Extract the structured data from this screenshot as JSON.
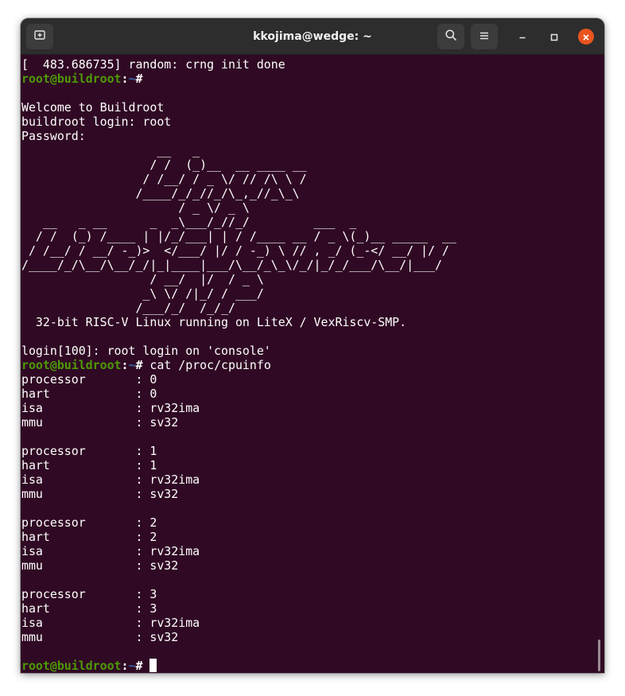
{
  "window": {
    "title": "kkojima@wedge: ~"
  },
  "titlebar": {
    "new_tab_icon": "new-tab-icon",
    "search_icon": "search-icon",
    "menu_icon": "hamburger-menu-icon",
    "minimize_icon": "minimize-icon",
    "maximize_icon": "maximize-icon",
    "close_icon": "close-icon"
  },
  "prompt": {
    "user_host": "root@buildroot",
    "colon": ":",
    "path": "~",
    "symbol": "# "
  },
  "terminal": {
    "lines": [
      "[  483.686735] random: crng init done",
      "",
      "",
      "Welcome to Buildroot",
      "buildroot login: root",
      "Password:",
      "                   __   _",
      "                  / /  (_)__  __ ____ __",
      "                 / /__/ / _ \\/ // /\\ \\ /",
      "                /____/_/_//_/\\_,_//_\\_\\",
      "                      / _ \\/ _ \\",
      "   __   _ __      _  _\\___/_//_/         ___  _",
      "  / /  (_) /____ | |/_/___| | / /____ __ / _ \\(_)__ _____  __",
      " / /__/ / __/ -_)>  </___/ |/ / -_) \\ // , _/ (_-</ __/ |/ /",
      "/____/_/\\__/\\__/_/|_|____|___/\\__/_\\_\\/_/|_/_/___/\\__/|___/",
      "                  / __/  |/  / _ \\",
      "                 _\\ \\/ /|_/ / ___/",
      "                /___/_/  /_/_/",
      "  32-bit RISC-V Linux running on LiteX / VexRiscv-SMP.",
      "",
      "login[100]: root login on 'console'",
      "",
      "processor       : 0",
      "hart            : 0",
      "isa             : rv32ima",
      "mmu             : sv32",
      "",
      "processor       : 1",
      "hart            : 1",
      "isa             : rv32ima",
      "mmu             : sv32",
      "",
      "processor       : 2",
      "hart            : 2",
      "isa             : rv32ima",
      "mmu             : sv32",
      "",
      "processor       : 3",
      "hart            : 3",
      "isa             : rv32ima",
      "mmu             : sv32",
      "",
      ""
    ],
    "prompt_commands": {
      "1": "",
      "21": "cat /proc/cpuinfo",
      "42": ""
    },
    "cursor_line": 42
  },
  "colors": {
    "terminal_bg": "#300a24",
    "prompt_user": "#4e9a06",
    "prompt_path": "#3465a4",
    "close_button": "#e95420",
    "titlebar_bg": "#2d2d2d"
  }
}
